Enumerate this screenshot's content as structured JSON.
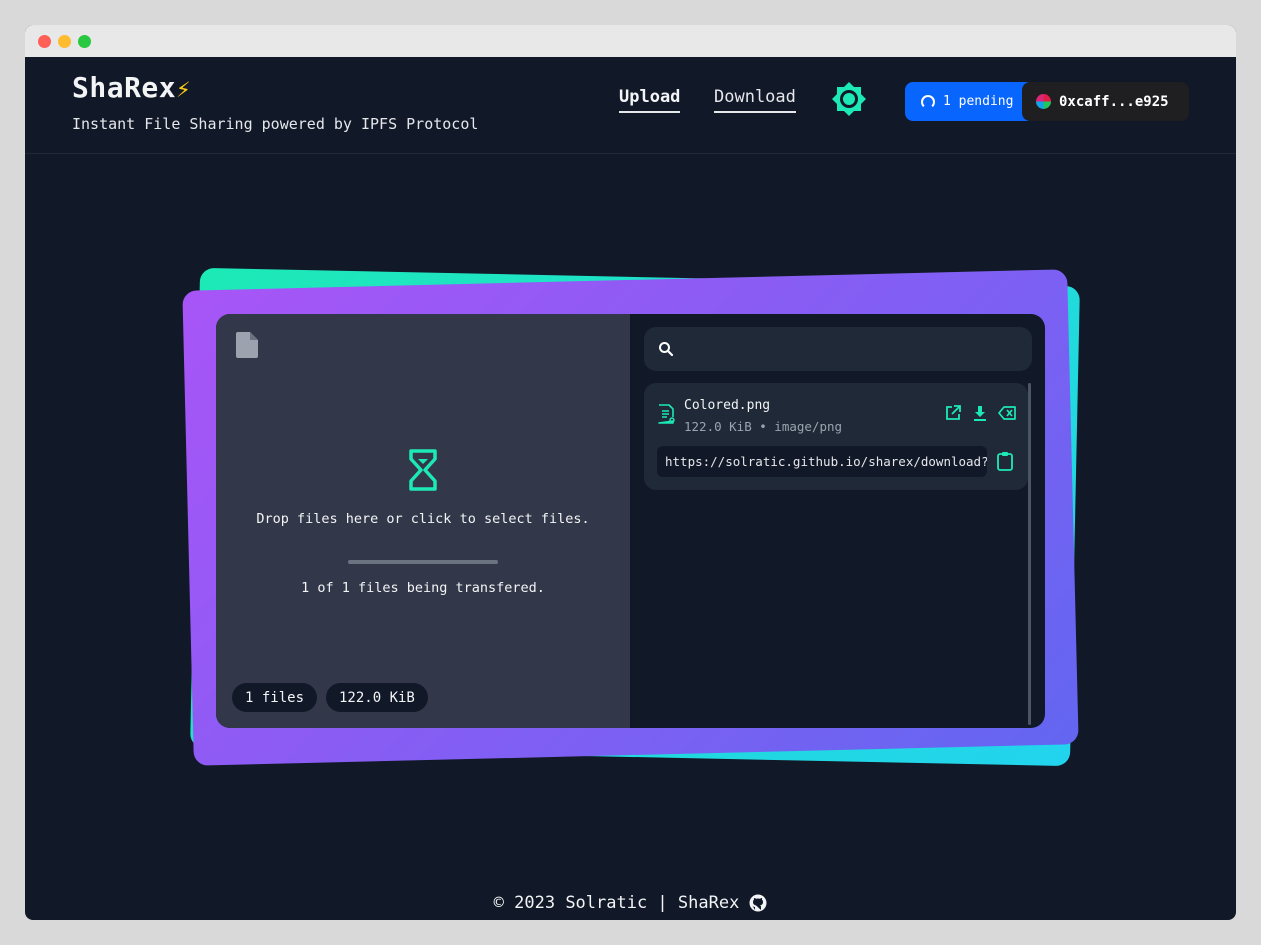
{
  "header": {
    "brand": "ShaRex",
    "brand_emoji": "⚡",
    "tagline": "Instant File Sharing powered by IPFS Protocol",
    "nav": {
      "upload": "Upload",
      "download": "Download"
    },
    "pending": "1 pending",
    "account": "0xcaff...e925"
  },
  "uploader": {
    "drop_text": "Drop files here or click to select files.",
    "transfer_text": "1 of 1 files being transfered.",
    "progress": 1.0,
    "files_chip": "1 files",
    "size_chip": "122.0 KiB"
  },
  "file_list": {
    "search_placeholder": "",
    "items": [
      {
        "name": "Colored.png",
        "meta": "122.0 KiB • image/png",
        "link": "https://solratic.github.io/sharex/download?cid=..."
      }
    ]
  },
  "footer": {
    "text": "© 2023 Solratic | ShaRex"
  },
  "colors": {
    "accent": "#1de9b6",
    "pending_blue": "#0866ff",
    "bg": "#111827"
  }
}
